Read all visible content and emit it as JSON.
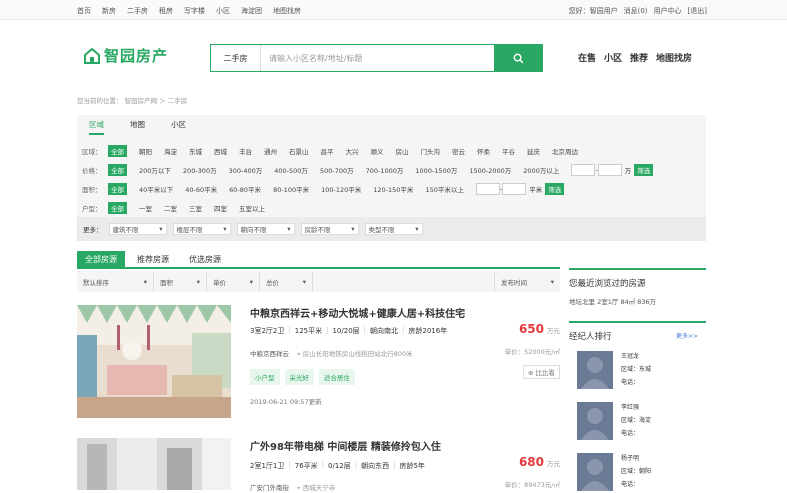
{
  "topbar": {
    "nav": [
      "首页",
      "新房",
      "二手房",
      "租房",
      "写字楼",
      "小区",
      "海淀团",
      "地图找房"
    ],
    "greeting": "您好：智园用户",
    "links": [
      "消息(0)",
      "用户中心",
      "[退出]"
    ]
  },
  "logo": {
    "text": "智园房产"
  },
  "search": {
    "select": "二手房",
    "placeholder": "请输入小区名称/地址/标题",
    "icon": "search-icon"
  },
  "mainnav": [
    "在售",
    "小区",
    "推荐",
    "地图找房"
  ],
  "breadcrumb": "您当前的位置： 智园房产网 ＞ 二手房",
  "filter": {
    "tabs": [
      "区域",
      "地图",
      "小区"
    ],
    "rows": [
      {
        "label": "区域：",
        "all": "全部",
        "options": [
          "朝阳",
          "海淀",
          "东城",
          "西城",
          "丰台",
          "通州",
          "石景山",
          "昌平",
          "大兴",
          "顺义",
          "房山",
          "门头沟",
          "密云",
          "怀柔",
          "平谷",
          "延庆",
          "北京周边"
        ]
      },
      {
        "label": "价格：",
        "all": "全部",
        "options": [
          "200万以下",
          "200-300万",
          "300-400万",
          "400-500万",
          "500-700万",
          "700-1000万",
          "1000-1500万",
          "1500-2000万",
          "2000万以上"
        ],
        "unit": "万",
        "btn": "筛选"
      },
      {
        "label": "面积：",
        "all": "全部",
        "options": [
          "40平米以下",
          "40-60平米",
          "60-80平米",
          "80-100平米",
          "100-120平米",
          "120-150平米",
          "150平米以上"
        ],
        "unit": "平米",
        "btn": "筛选"
      },
      {
        "label": "户型：",
        "all": "全部",
        "options": [
          "一室",
          "二室",
          "三室",
          "四室",
          "五室以上"
        ]
      }
    ],
    "more_label": "更多：",
    "more": [
      "建筑不限",
      "楼层不限",
      "朝向不限",
      "房龄不限",
      "类型不限"
    ]
  },
  "list": {
    "tabs": [
      "全部房源",
      "推荐房源",
      "优选房源"
    ],
    "sort": [
      "默认排序",
      "面积",
      "单价",
      "总价"
    ],
    "publish": "发布时间"
  },
  "listings": [
    {
      "title": "中粮京西祥云+移动大悦城+健康人居+科技住宅",
      "layout": "3室2厅2卫",
      "area": "125平米",
      "floor": "10/20层",
      "orient": "朝向南北",
      "age": "房龄2016年",
      "community": "中粮京西祥云",
      "address": "房山长阳地铁房山线稻田站北行800米",
      "tags": [
        "小户型",
        "采光好",
        "适合居住"
      ],
      "date": "2019-06-21 09:57更新",
      "price": "650",
      "price_unit": "万元",
      "unit_price": "单价：52000元/㎡",
      "compare": "比比看"
    },
    {
      "title": "广外98年带电梯 中间楼层 精装修拎包入住",
      "layout": "2室1厅1卫",
      "area": "76平米",
      "floor": "0/12层",
      "orient": "朝向东西",
      "age": "房龄5年",
      "community": "广安门外南街",
      "address": "西城天宁寺",
      "price": "680",
      "price_unit": "万元",
      "unit_price": "单价：89473元/㎡"
    }
  ],
  "sidebar": {
    "recent_title": "您最近浏览过的房源",
    "recent_item": "地坛北里 2室1厅 84㎡ 836万",
    "agents_title": "经纪人排行",
    "more": "更多>>",
    "agents": [
      {
        "name": "王冠龙",
        "area": "区域：东城",
        "phone": "电话："
      },
      {
        "name": "李红强",
        "area": "区域：海淀",
        "phone": "电话："
      },
      {
        "name": "杨子明",
        "area": "区域：朝阳",
        "phone": "电话："
      }
    ]
  }
}
